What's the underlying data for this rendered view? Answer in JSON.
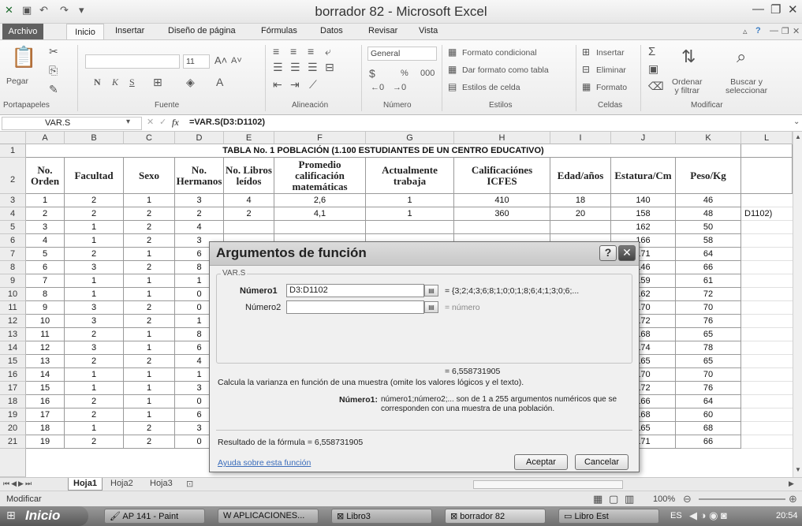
{
  "window": {
    "title": "borrador 82  -  Microsoft Excel"
  },
  "tabs": [
    "Archivo",
    "Inicio",
    "Insertar",
    "Diseño de página",
    "Fórmulas",
    "Datos",
    "Revisar",
    "Vista"
  ],
  "ribbon": {
    "paste_label": "Pegar",
    "font_size": "11",
    "number_format": "General",
    "percent": "%",
    "thousands": "000",
    "styles": [
      "Formato condicional",
      "Dar formato como tabla",
      "Estilos de celda"
    ],
    "cells": [
      "Insertar",
      "Eliminar",
      "Formato"
    ],
    "sort_label": "Ordenar\ny filtrar",
    "find_label": "Buscar y\nseleccionar",
    "groups": [
      "Portapapeles",
      "Fuente",
      "Alineación",
      "Número",
      "Estilos",
      "Celdas",
      "Modificar"
    ]
  },
  "formula_bar": {
    "name_box": "VAR.S",
    "formula": "=VAR.S(D3:D1102)",
    "fx": "fx"
  },
  "sheet": {
    "columns": [
      "A",
      "B",
      "C",
      "D",
      "E",
      "F",
      "G",
      "H",
      "I",
      "J",
      "K",
      "L"
    ],
    "title_row": "TABLA No. 1 POBLACIÓN (1.100 ESTUDIANTES DE UN CENTRO EDUCATIVO)",
    "headers": [
      "No.\nOrden",
      "Facultad",
      "Sexo",
      "No.\nHermanos",
      "No. Libros\nleídos",
      "Promedio\ncalificación\nmatemáticas",
      "Actualmente\ntrabaja",
      "Calificaciónes\nICFES",
      "Edad/años",
      "Estatura/Cm",
      "Peso/Kg"
    ],
    "row_numbers": [
      "1",
      "2",
      "3",
      "4",
      "5",
      "6",
      "7",
      "8",
      "9",
      "10",
      "11",
      "12",
      "13",
      "14",
      "15",
      "16",
      "17",
      "18",
      "19",
      "20",
      "21"
    ],
    "rows": [
      [
        "1",
        "2",
        "1",
        "3",
        "4",
        "2,6",
        "1",
        "410",
        "18",
        "140",
        "46"
      ],
      [
        "2",
        "2",
        "2",
        "2",
        "2",
        "4,1",
        "1",
        "360",
        "20",
        "158",
        "48"
      ],
      [
        "3",
        "1",
        "2",
        "4",
        "",
        "",
        "",
        "",
        "",
        "162",
        "50"
      ],
      [
        "4",
        "1",
        "2",
        "3",
        "",
        "",
        "",
        "",
        "",
        "166",
        "58"
      ],
      [
        "5",
        "2",
        "1",
        "6",
        "",
        "",
        "",
        "",
        "",
        "171",
        "64"
      ],
      [
        "6",
        "3",
        "2",
        "8",
        "",
        "",
        "",
        "",
        "",
        "146",
        "66"
      ],
      [
        "7",
        "1",
        "1",
        "1",
        "",
        "",
        "",
        "",
        "",
        "159",
        "61"
      ],
      [
        "8",
        "1",
        "1",
        "0",
        "",
        "",
        "",
        "",
        "",
        "162",
        "72"
      ],
      [
        "9",
        "3",
        "2",
        "0",
        "",
        "",
        "",
        "",
        "",
        "170",
        "70"
      ],
      [
        "10",
        "3",
        "2",
        "1",
        "",
        "",
        "",
        "",
        "",
        "172",
        "76"
      ],
      [
        "11",
        "2",
        "1",
        "8",
        "",
        "",
        "",
        "",
        "",
        "168",
        "65"
      ],
      [
        "12",
        "3",
        "1",
        "6",
        "",
        "",
        "",
        "",
        "",
        "174",
        "78"
      ],
      [
        "13",
        "2",
        "2",
        "4",
        "",
        "",
        "",
        "",
        "",
        "165",
        "65"
      ],
      [
        "14",
        "1",
        "1",
        "1",
        "",
        "",
        "",
        "",
        "",
        "170",
        "70"
      ],
      [
        "15",
        "1",
        "1",
        "3",
        "",
        "",
        "",
        "",
        "",
        "172",
        "76"
      ],
      [
        "16",
        "2",
        "1",
        "0",
        "",
        "",
        "",
        "",
        "",
        "166",
        "64"
      ],
      [
        "17",
        "2",
        "1",
        "6",
        "",
        "",
        "",
        "",
        "",
        "168",
        "60"
      ],
      [
        "18",
        "1",
        "2",
        "3",
        "",
        "",
        "",
        "",
        "",
        "165",
        "68"
      ],
      [
        "19",
        "2",
        "2",
        "0",
        "",
        "",
        "",
        "",
        "",
        "171",
        "66"
      ]
    ],
    "l4_value": "D1102)"
  },
  "dialog": {
    "title": "Argumentos de función",
    "group_label": "VAR.S",
    "arg1_label": "Número1",
    "arg1_value": "D3:D1102",
    "arg1_result": "=  {3;2;4;3;6;8;1;0;0;1;8;6;4;1;3;0;6;...",
    "arg2_label": "Número2",
    "arg2_result": "=  número",
    "total": "=  6,558731905",
    "description": "Calcula la varianza en función de una muestra (omite los valores lógicos y el texto).",
    "param_name": "Número1:",
    "param_desc": "número1;número2;... son de 1 a 255 argumentos numéricos que se\ncorresponden con una muestra de una población.",
    "result_label": "Resultado de la fórmula =  6,558731905",
    "help_link": "Ayuda sobre esta función",
    "ok": "Aceptar",
    "cancel": "Cancelar"
  },
  "sheet_tabs": [
    "Hoja1",
    "Hoja2",
    "Hoja3"
  ],
  "status": {
    "mode": "Modificar",
    "zoom": "100%"
  },
  "taskbar": {
    "start": "Inicio",
    "items": [
      "AP 141 - Paint",
      "APLICACIONES...",
      "Libro3",
      "borrador 82",
      "Libro Est"
    ],
    "lang": "ES",
    "time": "20:54"
  }
}
